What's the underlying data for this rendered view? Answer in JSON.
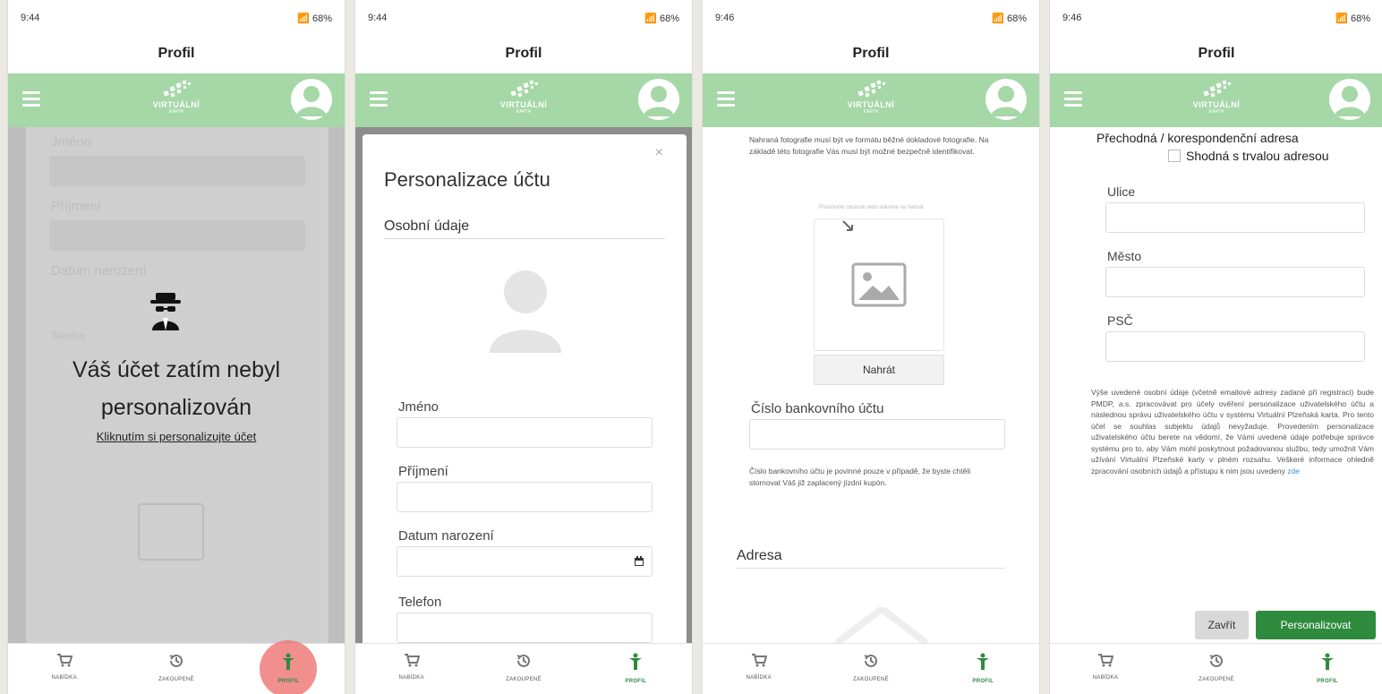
{
  "shared": {
    "app_title": "Profil",
    "logo_text": "VIRTUÁLNÍ",
    "logo_sub": "KARTA",
    "battery": "68%",
    "nav": [
      {
        "label": "NABÍDKA"
      },
      {
        "label": "ZAKOUPENÉ"
      },
      {
        "label": "PROFIL"
      }
    ],
    "brand_green": "#a5d7a7",
    "accent_green": "#2e8b3e"
  },
  "phone1": {
    "time": "9:44",
    "bg_fields": [
      "Jméno",
      "Příjmení",
      "Datum narození",
      "Telefon"
    ],
    "heading": "Váš účet zatím nebyl personalizován",
    "link": "Kliknutím si personalizujte účet"
  },
  "phone2": {
    "time": "9:44",
    "modal_title": "Personalizace účtu",
    "section": "Osobní údaje",
    "close": "×",
    "fields": [
      "Jméno",
      "Příjmení",
      "Datum narození",
      "Telefon"
    ]
  },
  "phone3": {
    "time": "9:46",
    "photo_note": "Nahraná fotografie musí být ve formátu běžné dokladové fotografie. Na základě této fotografie Vás musí být možné bezpečně identifikovat.",
    "drop_hint": "Přetáhněte obrázek nebo klikněte na Nahrát",
    "upload_button": "Nahrát",
    "bank_label": "Číslo bankovního účtu",
    "bank_note": "Číslo bankovního účtu je povinné pouze v případě, že byste chtěli stornovat Váš již zaplacený jízdní kupón.",
    "address": "Adresa"
  },
  "phone4": {
    "time": "9:46",
    "heading": "Přechodná / korespondenční adresa",
    "checkbox_label": "Shodná s trvalou adresou",
    "fields": [
      "Ulice",
      "Město",
      "PSČ"
    ],
    "legal": "Výše uvedené osobní údaje (včetně emailové adresy zadané při registraci) bude PMDP, a.s. zpracovávat pro účely ověření personalizace uživatelského účtu a následnou správu uživatelského účtu v systému Virtuální Plzeňská karta. Pro tento účel se souhlas subjektu údajů nevyžaduje. Provedením personalizace uživatelského účtu berete na vědomí, že Vámi uvedené údaje potřebuje správce systému pro to, aby Vám mohl poskytnout požadovanou službu, tedy umožnit Vám užívání Virtuální Plzeňské karty v plném rozsahu. Veškeré informace ohledně zpracování osobních údajů a přístupu k nim jsou uvedeny",
    "legal_link": "zde",
    "close_button": "Zavřít",
    "submit_button": "Personalizovat"
  }
}
